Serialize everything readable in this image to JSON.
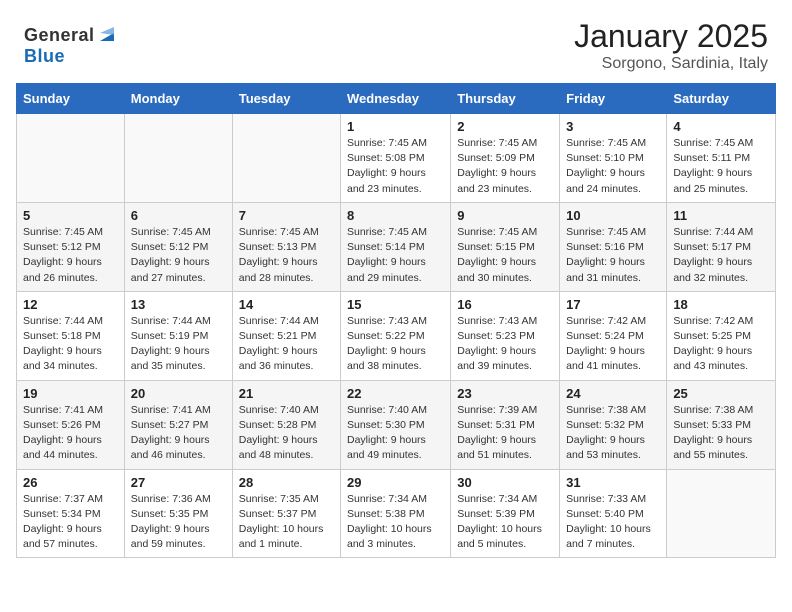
{
  "header": {
    "logo_general": "General",
    "logo_blue": "Blue",
    "month": "January 2025",
    "location": "Sorgono, Sardinia, Italy"
  },
  "weekdays": [
    "Sunday",
    "Monday",
    "Tuesday",
    "Wednesday",
    "Thursday",
    "Friday",
    "Saturday"
  ],
  "weeks": [
    [
      {
        "day": "",
        "info": ""
      },
      {
        "day": "",
        "info": ""
      },
      {
        "day": "",
        "info": ""
      },
      {
        "day": "1",
        "info": "Sunrise: 7:45 AM\nSunset: 5:08 PM\nDaylight: 9 hours and 23 minutes."
      },
      {
        "day": "2",
        "info": "Sunrise: 7:45 AM\nSunset: 5:09 PM\nDaylight: 9 hours and 23 minutes."
      },
      {
        "day": "3",
        "info": "Sunrise: 7:45 AM\nSunset: 5:10 PM\nDaylight: 9 hours and 24 minutes."
      },
      {
        "day": "4",
        "info": "Sunrise: 7:45 AM\nSunset: 5:11 PM\nDaylight: 9 hours and 25 minutes."
      }
    ],
    [
      {
        "day": "5",
        "info": "Sunrise: 7:45 AM\nSunset: 5:12 PM\nDaylight: 9 hours and 26 minutes."
      },
      {
        "day": "6",
        "info": "Sunrise: 7:45 AM\nSunset: 5:12 PM\nDaylight: 9 hours and 27 minutes."
      },
      {
        "day": "7",
        "info": "Sunrise: 7:45 AM\nSunset: 5:13 PM\nDaylight: 9 hours and 28 minutes."
      },
      {
        "day": "8",
        "info": "Sunrise: 7:45 AM\nSunset: 5:14 PM\nDaylight: 9 hours and 29 minutes."
      },
      {
        "day": "9",
        "info": "Sunrise: 7:45 AM\nSunset: 5:15 PM\nDaylight: 9 hours and 30 minutes."
      },
      {
        "day": "10",
        "info": "Sunrise: 7:45 AM\nSunset: 5:16 PM\nDaylight: 9 hours and 31 minutes."
      },
      {
        "day": "11",
        "info": "Sunrise: 7:44 AM\nSunset: 5:17 PM\nDaylight: 9 hours and 32 minutes."
      }
    ],
    [
      {
        "day": "12",
        "info": "Sunrise: 7:44 AM\nSunset: 5:18 PM\nDaylight: 9 hours and 34 minutes."
      },
      {
        "day": "13",
        "info": "Sunrise: 7:44 AM\nSunset: 5:19 PM\nDaylight: 9 hours and 35 minutes."
      },
      {
        "day": "14",
        "info": "Sunrise: 7:44 AM\nSunset: 5:21 PM\nDaylight: 9 hours and 36 minutes."
      },
      {
        "day": "15",
        "info": "Sunrise: 7:43 AM\nSunset: 5:22 PM\nDaylight: 9 hours and 38 minutes."
      },
      {
        "day": "16",
        "info": "Sunrise: 7:43 AM\nSunset: 5:23 PM\nDaylight: 9 hours and 39 minutes."
      },
      {
        "day": "17",
        "info": "Sunrise: 7:42 AM\nSunset: 5:24 PM\nDaylight: 9 hours and 41 minutes."
      },
      {
        "day": "18",
        "info": "Sunrise: 7:42 AM\nSunset: 5:25 PM\nDaylight: 9 hours and 43 minutes."
      }
    ],
    [
      {
        "day": "19",
        "info": "Sunrise: 7:41 AM\nSunset: 5:26 PM\nDaylight: 9 hours and 44 minutes."
      },
      {
        "day": "20",
        "info": "Sunrise: 7:41 AM\nSunset: 5:27 PM\nDaylight: 9 hours and 46 minutes."
      },
      {
        "day": "21",
        "info": "Sunrise: 7:40 AM\nSunset: 5:28 PM\nDaylight: 9 hours and 48 minutes."
      },
      {
        "day": "22",
        "info": "Sunrise: 7:40 AM\nSunset: 5:30 PM\nDaylight: 9 hours and 49 minutes."
      },
      {
        "day": "23",
        "info": "Sunrise: 7:39 AM\nSunset: 5:31 PM\nDaylight: 9 hours and 51 minutes."
      },
      {
        "day": "24",
        "info": "Sunrise: 7:38 AM\nSunset: 5:32 PM\nDaylight: 9 hours and 53 minutes."
      },
      {
        "day": "25",
        "info": "Sunrise: 7:38 AM\nSunset: 5:33 PM\nDaylight: 9 hours and 55 minutes."
      }
    ],
    [
      {
        "day": "26",
        "info": "Sunrise: 7:37 AM\nSunset: 5:34 PM\nDaylight: 9 hours and 57 minutes."
      },
      {
        "day": "27",
        "info": "Sunrise: 7:36 AM\nSunset: 5:35 PM\nDaylight: 9 hours and 59 minutes."
      },
      {
        "day": "28",
        "info": "Sunrise: 7:35 AM\nSunset: 5:37 PM\nDaylight: 10 hours and 1 minute."
      },
      {
        "day": "29",
        "info": "Sunrise: 7:34 AM\nSunset: 5:38 PM\nDaylight: 10 hours and 3 minutes."
      },
      {
        "day": "30",
        "info": "Sunrise: 7:34 AM\nSunset: 5:39 PM\nDaylight: 10 hours and 5 minutes."
      },
      {
        "day": "31",
        "info": "Sunrise: 7:33 AM\nSunset: 5:40 PM\nDaylight: 10 hours and 7 minutes."
      },
      {
        "day": "",
        "info": ""
      }
    ]
  ]
}
